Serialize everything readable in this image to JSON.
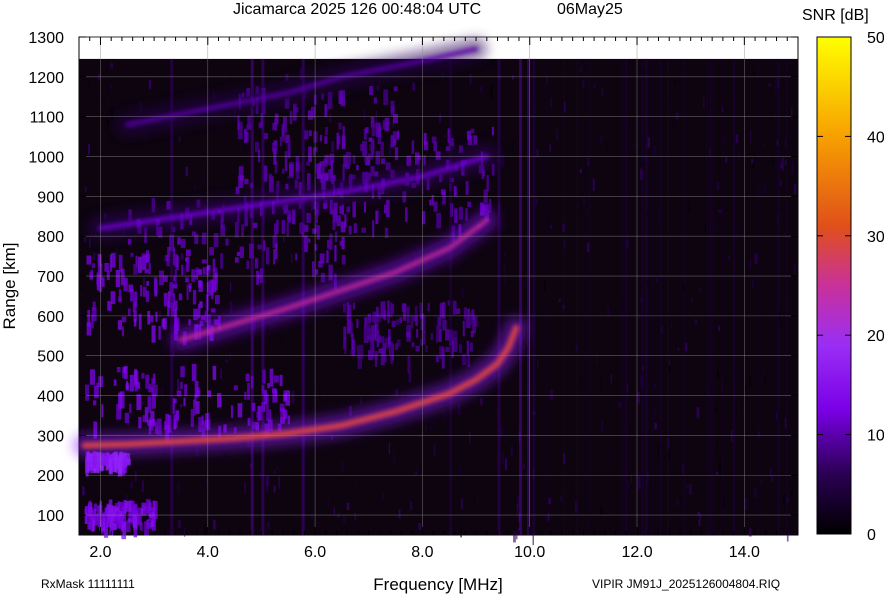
{
  "header": {
    "title": "Jicamarca 2025 126 00:48:04 UTC",
    "date": "06May25"
  },
  "footer": {
    "rxmask": "RxMask 11111111",
    "file": "VIPIR  JM91J_2025126004804.RIQ"
  },
  "chart_data": {
    "type": "heatmap",
    "title": "Jicamarca 2025 126 00:48:04 UTC",
    "xlabel": "Frequency [MHz]",
    "ylabel": "Range [km]",
    "xlim": [
      1.6,
      15.0
    ],
    "ylim": [
      50,
      1300
    ],
    "x_ticks": [
      2.0,
      4.0,
      6.0,
      8.0,
      10.0,
      12.0,
      14.0
    ],
    "x_tick_labels": [
      "2.0",
      "4.0",
      "6.0",
      "8.0",
      "10.0",
      "12.0",
      "14.0"
    ],
    "y_ticks": [
      100,
      200,
      300,
      400,
      500,
      600,
      700,
      800,
      900,
      1000,
      1100,
      1200,
      1300
    ],
    "y_tick_labels": [
      "100",
      "200",
      "300",
      "400",
      "500",
      "600",
      "700",
      "800",
      "900",
      "1000",
      "1100",
      "1200",
      "1300"
    ],
    "grid": true,
    "colorbar": {
      "label": "SNR [dB]",
      "range": [
        0,
        50
      ],
      "ticks": [
        0,
        10,
        20,
        30,
        40,
        50
      ],
      "tick_labels": [
        "0",
        "10",
        "20",
        "30",
        "40",
        "50"
      ],
      "colors": [
        "#000000",
        "#330066",
        "#7a00e6",
        "#9933ff",
        "#cc2a8a",
        "#e0501a",
        "#f7a000",
        "#ffff00"
      ]
    },
    "traces": [
      {
        "freq": [
          1.7,
          2.5,
          3.5,
          4.5,
          5.5,
          6.5,
          7.5,
          8.5,
          9.0,
          9.4,
          9.6,
          9.75
        ],
        "range": [
          275,
          278,
          285,
          293,
          305,
          325,
          360,
          405,
          440,
          480,
          520,
          570
        ],
        "snr": 33
      },
      {
        "freq": [
          3.5,
          4.5,
          5.5,
          6.5,
          7.5,
          8.5,
          9.2
        ],
        "range": [
          540,
          580,
          620,
          665,
          710,
          770,
          840
        ],
        "snr": 28
      },
      {
        "freq": [
          2.0,
          3.5,
          5.0,
          6.5,
          8.0,
          9.2
        ],
        "range": [
          820,
          850,
          880,
          910,
          950,
          1000
        ],
        "snr": 14
      },
      {
        "freq": [
          2.5,
          4.0,
          5.5,
          6.5,
          8.0,
          9.0
        ],
        "range": [
          1080,
          1120,
          1160,
          1200,
          1240,
          1270
        ],
        "snr": 11
      }
    ]
  }
}
